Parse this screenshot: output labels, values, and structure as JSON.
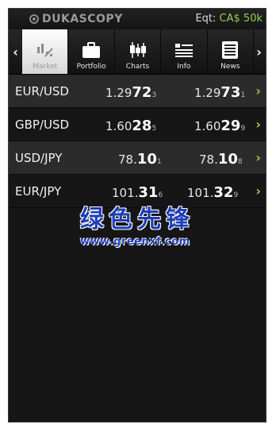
{
  "statusbar": {
    "logo_text": "DUKASCOPY",
    "equity_label": "Eqt:",
    "equity_value": "CA$ 50k"
  },
  "nav": {
    "left_arrow": "‹",
    "right_arrow": "›",
    "tabs": [
      {
        "label": "Market",
        "icon": "market-icon",
        "active": true
      },
      {
        "label": "Portfolio",
        "icon": "portfolio-icon",
        "active": false
      },
      {
        "label": "Charts",
        "icon": "charts-icon",
        "active": false
      },
      {
        "label": "Info",
        "icon": "info-icon",
        "active": false
      },
      {
        "label": "News",
        "icon": "news-icon",
        "active": false
      }
    ]
  },
  "quotes": [
    {
      "pair": "EUR/USD",
      "bid": {
        "prefix": "1.29",
        "big": "72",
        "pip": "3"
      },
      "ask": {
        "prefix": "1.29",
        "big": "73",
        "pip": "1"
      }
    },
    {
      "pair": "GBP/USD",
      "bid": {
        "prefix": "1.60",
        "big": "28",
        "pip": "5"
      },
      "ask": {
        "prefix": "1.60",
        "big": "29",
        "pip": "9"
      }
    },
    {
      "pair": "USD/JPY",
      "bid": {
        "prefix": "78.",
        "big": "10",
        "pip": "1"
      },
      "ask": {
        "prefix": "78.",
        "big": "10",
        "pip": "8"
      }
    },
    {
      "pair": "EUR/JPY",
      "bid": {
        "prefix": "101.",
        "big": "31",
        "pip": "6"
      },
      "ask": {
        "prefix": "101.",
        "big": "32",
        "pip": "9"
      }
    }
  ],
  "row_chevron": "›",
  "watermark": {
    "title": "绿色先锋",
    "url": "www.greenxf.com"
  },
  "colors": {
    "accent_green": "#8fd14f",
    "background": "#161616",
    "row_alt": "#2b2b2b",
    "watermark_blue": "#1f3fb8"
  }
}
